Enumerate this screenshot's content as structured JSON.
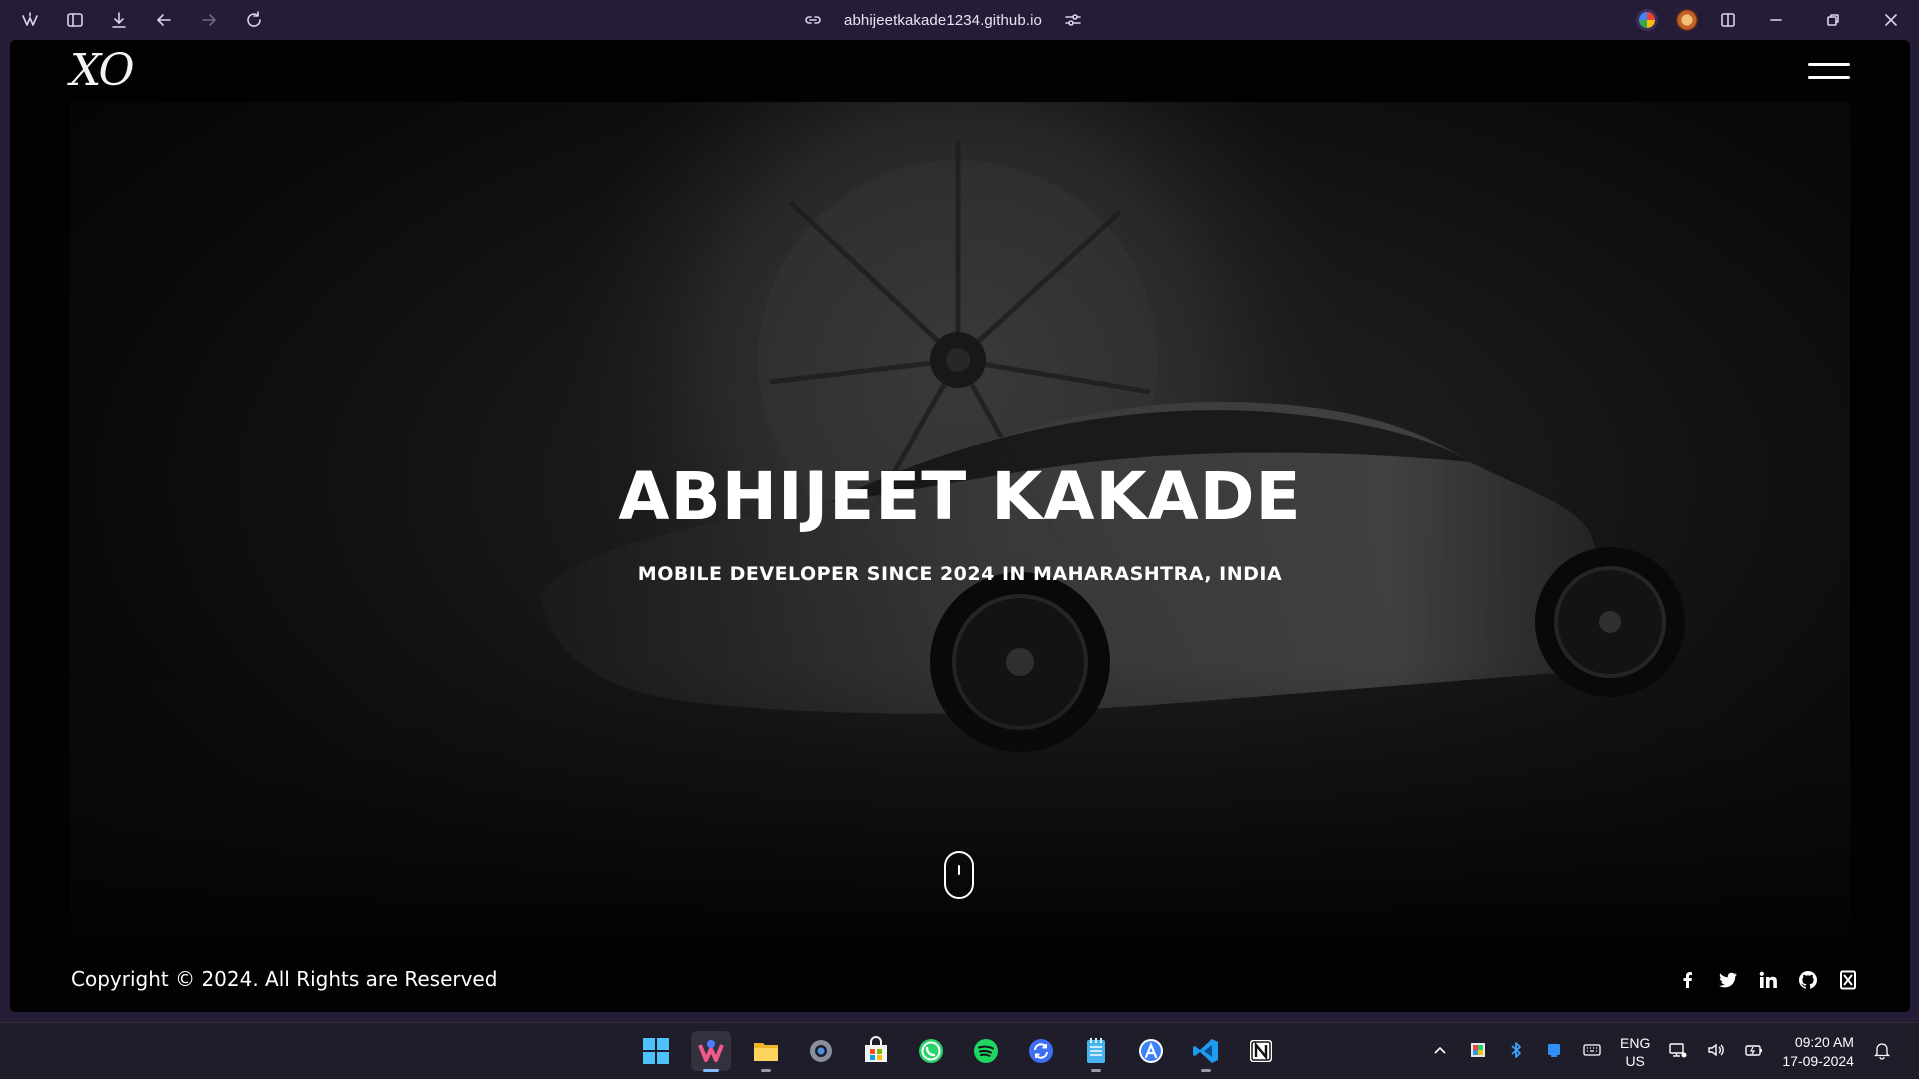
{
  "browser": {
    "url": "abhijeetkakade1234.github.io",
    "icons": [
      "browser-logo-icon",
      "sidebar-icon",
      "download-icon",
      "back-icon",
      "forward-icon",
      "reload-icon",
      "link-icon",
      "site-settings-icon",
      "extension-icon",
      "extension-icon",
      "split-view-icon",
      "minimize-icon",
      "restore-icon",
      "close-icon"
    ]
  },
  "site": {
    "logo_text": "XO",
    "hero_title": "ABHIJEET KAKADE",
    "hero_subtitle": "MOBILE DEVELOPER SINCE 2024 IN MAHARASHTRA, INDIA",
    "copyright": "Copyright © 2024. All Rights are Reserved",
    "socials": [
      "facebook-icon",
      "twitter-icon",
      "linkedin-icon",
      "github-icon",
      "x-icon"
    ]
  },
  "taskbar": {
    "apps": [
      "windows-start-icon",
      "browser-icon",
      "file-explorer-icon",
      "settings-icon",
      "microsoft-store-icon",
      "whatsapp-icon",
      "spotify-icon",
      "sync-icon",
      "notepad-icon",
      "app-icon",
      "vscode-icon",
      "notion-icon"
    ],
    "lang_primary": "ENG",
    "lang_secondary": "US",
    "time": "09:20 AM",
    "date": "17-09-2024"
  },
  "colors": {
    "titlebar": "#251d38",
    "page_bg": "#020203",
    "taskbar": "#1f1d29",
    "accent": "#7fb9ff"
  }
}
